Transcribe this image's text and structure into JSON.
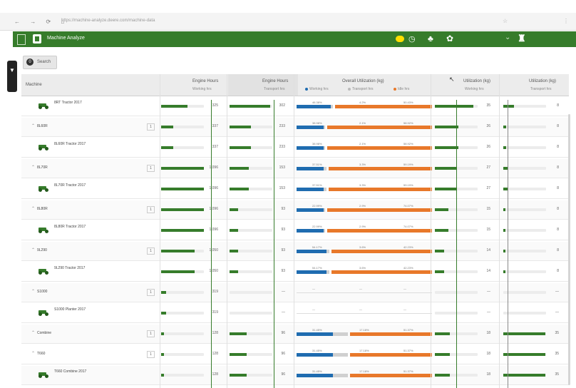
{
  "browser": {
    "nav_glyphs": "← → ⟳ ⌂",
    "url": "https://machine-analyze.deere.com/machine-data",
    "extra_icon": "☆",
    "menu_icon": "⋮"
  },
  "app": {
    "title": "Machine Analyze",
    "brand_color": "#367c2b",
    "header_icons": [
      "help-badge-icon",
      "clock-icon",
      "bell-icon",
      "settings-icon",
      "chevron-icon",
      "user-icon"
    ]
  },
  "filter": {
    "label": "Search",
    "icon": "0"
  },
  "columns": {
    "machine": "Machine",
    "engine_hours": {
      "title": "Engine Hours",
      "sub": "Working hrs"
    },
    "engine_hours2": {
      "title": "Engine Hours",
      "sub": "Transport hrs"
    },
    "overall": {
      "title": "Overall Utilization (kg)",
      "legend": [
        "Working hrs",
        "Transport hrs",
        "Idle hrs"
      ]
    },
    "util_a": {
      "title": "Utilization (kg)",
      "sub": "Working hrs"
    },
    "util_b": {
      "title": "Utilization (kg)",
      "sub": "Transport hrs"
    }
  },
  "colors": {
    "working": "#1f6cb0",
    "transport": "#d0d0d0",
    "idle": "#e8782a",
    "bar": "#367c2b"
  },
  "rows": [
    {
      "kind": "machine",
      "name": "8RT Tractor 2017",
      "sub": "",
      "h1": "325",
      "f1": 0.62,
      "h2": "302",
      "f2": 0.95,
      "b": "46.38%",
      "g": "4.2%",
      "o": "50.43%",
      "wb": 0.25,
      "wg": 0.02,
      "wo": 0.73,
      "u1": "35",
      "fu1": 0.9,
      "u2": "8",
      "fu2": 0.25
    },
    {
      "kind": "group",
      "name": "8L60R",
      "count": "1",
      "h1": "337",
      "f1": 0.28,
      "h2": "233",
      "f2": 0.5,
      "b": "38.98%",
      "g": "2.1%",
      "o": "58.92%",
      "wb": 0.2,
      "wg": 0.01,
      "wo": 0.79,
      "u1": "26",
      "fu1": 0.55,
      "u2": "8",
      "fu2": 0.06
    },
    {
      "kind": "machine",
      "name": "8L60R Tractor 2017",
      "sub": "",
      "h1": "337",
      "f1": 0.28,
      "h2": "233",
      "f2": 0.5,
      "b": "38.98%",
      "g": "2.1%",
      "o": "58.92%",
      "wb": 0.2,
      "wg": 0.01,
      "wo": 0.79,
      "u1": "26",
      "fu1": 0.55,
      "u2": "8",
      "fu2": 0.06
    },
    {
      "kind": "group",
      "name": "8L70R",
      "count": "1",
      "h1": "1,096",
      "f1": 1.0,
      "h2": "153",
      "f2": 0.45,
      "b": "37.51%",
      "g": "3.3%",
      "o": "59.19%",
      "wb": 0.2,
      "wg": 0.02,
      "wo": 0.78,
      "u1": "27",
      "fu1": 0.52,
      "u2": "8",
      "fu2": 0.1
    },
    {
      "kind": "machine",
      "name": "8L70R Tractor 2017",
      "sub": "",
      "h1": "1,096",
      "f1": 1.0,
      "h2": "153",
      "f2": 0.45,
      "b": "37.51%",
      "g": "3.3%",
      "o": "59.19%",
      "wb": 0.2,
      "wg": 0.02,
      "wo": 0.78,
      "u1": "27",
      "fu1": 0.52,
      "u2": "8",
      "fu2": 0.1
    },
    {
      "kind": "group",
      "name": "8L80R",
      "count": "1",
      "h1": "1,096",
      "f1": 1.0,
      "h2": "93",
      "f2": 0.2,
      "b": "22.99%",
      "g": "2.9%",
      "o": "74.07%",
      "wb": 0.2,
      "wg": 0.01,
      "wo": 0.79,
      "u1": "15",
      "fu1": 0.32,
      "u2": "8",
      "fu2": 0.05
    },
    {
      "kind": "machine",
      "name": "8L80R Tractor 2017",
      "sub": "",
      "h1": "1,096",
      "f1": 1.0,
      "h2": "93",
      "f2": 0.2,
      "b": "22.99%",
      "g": "2.9%",
      "o": "74.07%",
      "wb": 0.2,
      "wg": 0.01,
      "wo": 0.79,
      "u1": "15",
      "fu1": 0.32,
      "u2": "8",
      "fu2": 0.05
    },
    {
      "kind": "group",
      "name": "9L290",
      "count": "1",
      "h1": "1,050",
      "f1": 0.78,
      "h2": "93",
      "f2": 0.2,
      "b": "54.17%",
      "g": "3.6%",
      "o": "42.23%",
      "wb": 0.22,
      "wg": 0.02,
      "wo": 0.76,
      "u1": "14",
      "fu1": 0.22,
      "u2": "8",
      "fu2": 0.05
    },
    {
      "kind": "machine",
      "name": "9L290 Tractor 2017",
      "sub": "",
      "h1": "1,050",
      "f1": 0.78,
      "h2": "93",
      "f2": 0.2,
      "b": "54.17%",
      "g": "3.6%",
      "o": "42.23%",
      "wb": 0.22,
      "wg": 0.02,
      "wo": 0.76,
      "u1": "14",
      "fu1": 0.22,
      "u2": "8",
      "fu2": 0.05
    },
    {
      "kind": "group",
      "name": "S1000",
      "count": "1",
      "h1": "319",
      "f1": 0.12,
      "h2": "—",
      "f2": 0.0,
      "b": "—",
      "g": "—",
      "o": "—",
      "wb": 0,
      "wg": 0,
      "wo": 0,
      "u1": "—",
      "fu1": 0,
      "u2": "—",
      "fu2": 0
    },
    {
      "kind": "machine",
      "name": "S1000 Planter 2017",
      "sub": "",
      "h1": "319",
      "f1": 0.12,
      "h2": "—",
      "f2": 0.0,
      "b": "—",
      "g": "—",
      "o": "—",
      "wb": 0,
      "wg": 0,
      "wo": 0,
      "u1": "—",
      "fu1": 0,
      "u2": "—",
      "fu2": 0
    },
    {
      "kind": "group",
      "name": "Combine",
      "count": "1",
      "h1": "128",
      "f1": 0.06,
      "h2": "96",
      "f2": 0.4,
      "b": "31.45%",
      "g": "17.18%",
      "o": "51.37%",
      "wb": 0.27,
      "wg": 0.11,
      "wo": 0.62,
      "u1": "18",
      "fu1": 0.35,
      "u2": "35",
      "fu2": 0.98
    },
    {
      "kind": "group",
      "name": "T660",
      "count": "1",
      "h1": "128",
      "f1": 0.06,
      "h2": "96",
      "f2": 0.4,
      "b": "31.45%",
      "g": "17.18%",
      "o": "51.37%",
      "wb": 0.27,
      "wg": 0.11,
      "wo": 0.62,
      "u1": "18",
      "fu1": 0.35,
      "u2": "35",
      "fu2": 0.98
    },
    {
      "kind": "machine",
      "name": "T660 Combine 2017",
      "sub": "",
      "h1": "128",
      "f1": 0.06,
      "h2": "96",
      "f2": 0.4,
      "b": "31.45%",
      "g": "17.18%",
      "o": "51.37%",
      "wb": 0.27,
      "wg": 0.11,
      "wo": 0.62,
      "u1": "18",
      "fu1": 0.35,
      "u2": "35",
      "fu2": 0.98
    }
  ]
}
